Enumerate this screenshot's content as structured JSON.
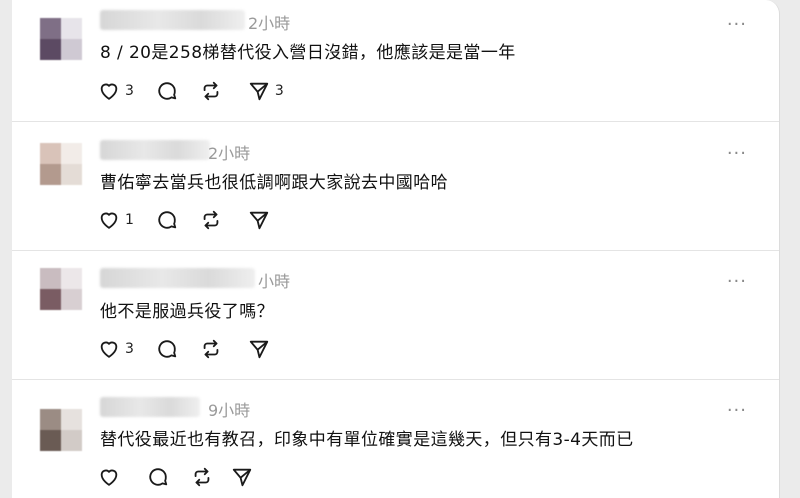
{
  "posts": [
    {
      "time": "2小時",
      "text": "8 / 20是258梯替代役入營日沒錯，他應該是是當一年",
      "likes": "3",
      "shares": "3",
      "more": "···"
    },
    {
      "time": "2小時",
      "text": "曹佑寧去當兵也很低調啊跟大家說去中國哈哈",
      "likes": "1",
      "shares": "",
      "more": "···"
    },
    {
      "time": "小時",
      "text": "他不是服過兵役了嗎？",
      "likes": "3",
      "shares": "",
      "more": "···"
    },
    {
      "time": "9小時",
      "text": "替代役最近也有教召，印象中有單位確實是這幾天，但只有3-4天而已",
      "likes": "",
      "shares": "",
      "more": "···"
    }
  ],
  "icons": {
    "like": "heart-icon",
    "reply": "comment-icon",
    "repost": "repost-icon",
    "share": "send-icon"
  },
  "colors": {
    "icon_stroke": "#1a1a1a",
    "meta_text": "#9a9a9a",
    "divider": "#e4e4e4"
  }
}
